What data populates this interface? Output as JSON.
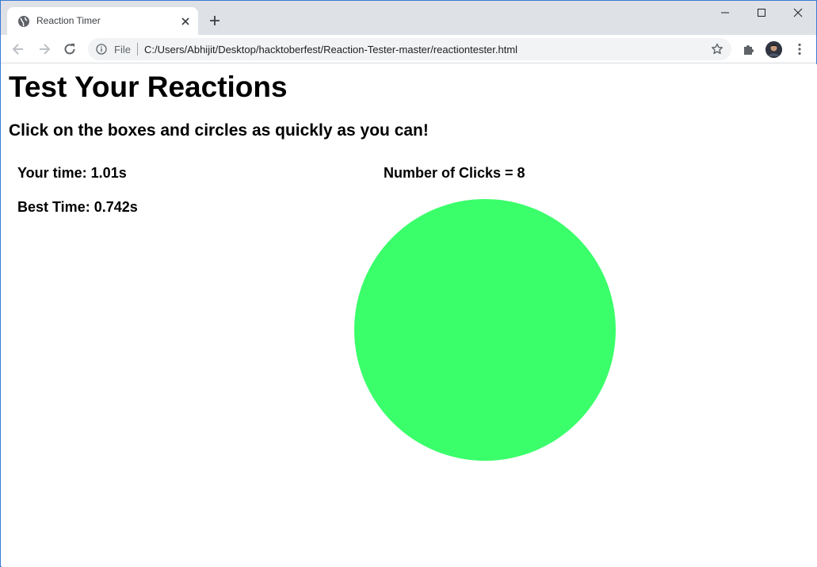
{
  "browser": {
    "tab": {
      "title": "Reaction Timer",
      "favicon": "globe-icon"
    },
    "address": {
      "scheme": "File",
      "url": "C:/Users/Abhijit/Desktop/hacktoberfest/Reaction-Tester-master/reactiontester.html"
    }
  },
  "page": {
    "title": "Test Your Reactions",
    "subtitle": "Click on the boxes and circles as quickly as you can!",
    "your_time": "Your time: 1.01s",
    "best_time": "Best Time: 0.742s",
    "clicks": "Number of Clicks = 8",
    "target": {
      "shape": "circle",
      "color": "#3aff6a"
    }
  },
  "colors": {
    "tabstrip": "#dee1e6",
    "omnibox": "#f1f3f4",
    "accent_border": "#3a7bd5"
  }
}
